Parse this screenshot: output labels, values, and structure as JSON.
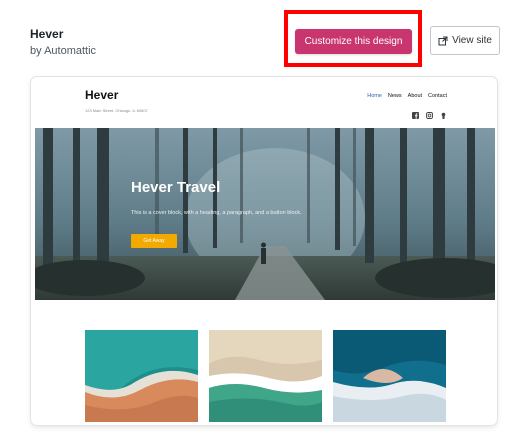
{
  "theme": {
    "name": "Hever",
    "author": "by Automattic"
  },
  "actions": {
    "customize_label": "Customize this design",
    "view_site_label": "View site"
  },
  "icons": {
    "view_site_icon": "external-link-icon",
    "social": [
      "facebook-icon",
      "instagram-icon",
      "github-icon"
    ]
  },
  "colors": {
    "customize_bg": "#c9356e",
    "highlight": "#ff0000",
    "cover_button": "#f2a900",
    "nav_active": "#2b5fad"
  },
  "preview": {
    "site_title": "Hever",
    "address": "123 Main Street, Chicago, IL 60607",
    "nav": [
      "Home",
      "News",
      "About",
      "Contact"
    ],
    "cover": {
      "title": "Hever Travel",
      "text": "This is a cover block, with a heading, a paragraph, and a button block.",
      "button": "Get Away"
    }
  }
}
